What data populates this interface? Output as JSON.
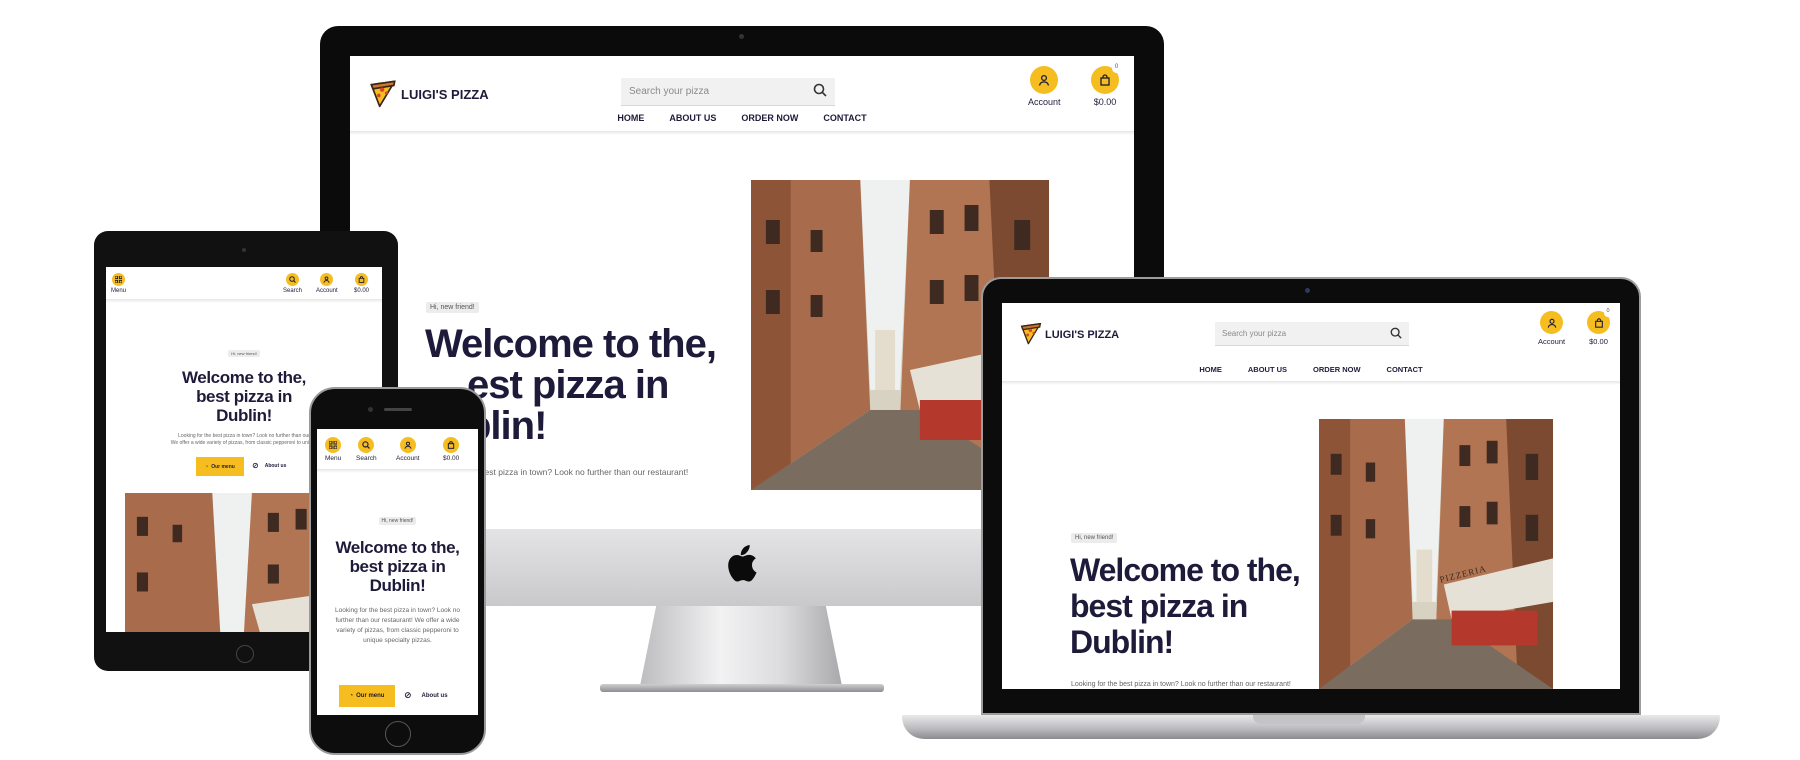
{
  "brand": {
    "name": "LUIGI'S PIZZA",
    "accent": "#f5bd1f",
    "ink": "#1e1b3a"
  },
  "header": {
    "search_placeholder": "Search your pizza",
    "account_label": "Account",
    "cart_total": "$0.00",
    "cart_count": "0",
    "menu_label": "Menu",
    "search_label": "Search"
  },
  "nav": [
    {
      "label": "HOME"
    },
    {
      "label": "ABOUT US"
    },
    {
      "label": "ORDER NOW"
    },
    {
      "label": "CONTACT"
    }
  ],
  "hero": {
    "chip": "Hi, new friend!",
    "title_line1": "Welcome to the,",
    "title_line2": "best pizza in",
    "title_line3": "Dublin!",
    "desktop_title_line2": "est pizza in",
    "desktop_title_line3": "blin!",
    "text_line1": "Looking for the best pizza in town? Look no further than our restaurant!",
    "text_short": "he best pizza in town? Look no further than our restaurant!",
    "tablet_text_line1": "Looking for the best pizza in town? Look no further than our",
    "tablet_text_line2": "We offer a wide variety of pizzas, from classic pepperoni to unique",
    "mobile_text": "Looking for the best pizza in town? Look no further than our restaurant! We offer a wide variety of pizzas, from classic pepperoni to unique specialty pizzas.",
    "primary_button": "Our menu",
    "secondary_button": "About us",
    "pizzeria_sign": "PIZZERIA"
  },
  "icons": {
    "logo": "pizza-slice-icon",
    "search": "search-icon",
    "account": "user-icon",
    "cart": "shopping-bag-icon",
    "menu": "grid-menu-icon",
    "about": "compass-icon",
    "apple": "apple-logo"
  }
}
